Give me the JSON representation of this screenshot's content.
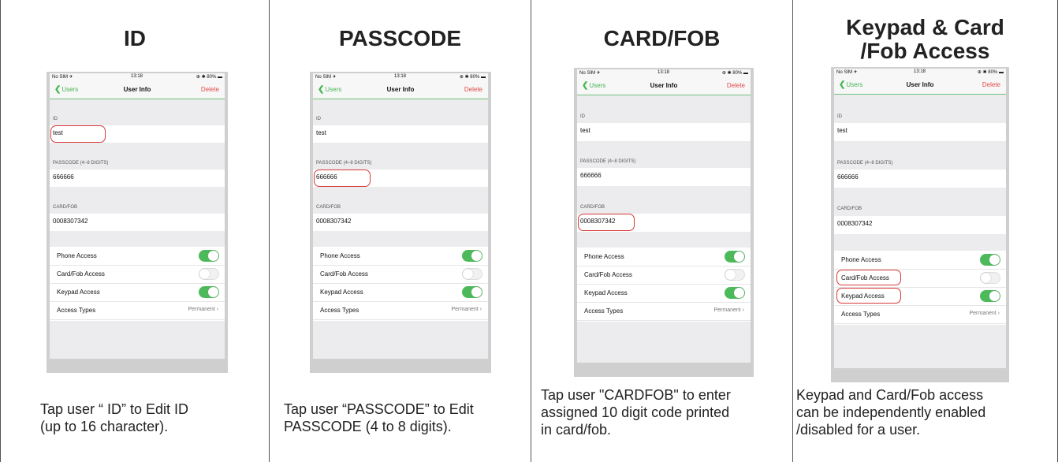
{
  "columns": [
    {
      "title": "ID",
      "caption": "Tap user “ ID” to Edit ID\n(up to 16 character)."
    },
    {
      "title": "PASSCODE",
      "caption": "Tap user “PASSCODE” to Edit\nPASSCODE (4 to 8 digits)."
    },
    {
      "title": "CARD/FOB",
      "caption": "Tap user \"CARDFOB\" to enter\nassigned 10 digit code printed\nin card/fob."
    },
    {
      "title": "Keypad & Card\n/Fob Access",
      "caption": "Keypad and Card/Fob access\ncan be independently enabled\n/disabled for a user."
    }
  ],
  "phone": {
    "status_left": "No SIM ✈",
    "status_time": "13:18",
    "status_right": "⊕ ✱ 80% ▬",
    "back_label": "Users",
    "nav_title": "User Info",
    "delete_label": "Delete",
    "id_header": "ID",
    "id_value": "test",
    "passcode_header": "PASSCODE (4~8 DIGITS)",
    "passcode_value": "666666",
    "card_header": "CARD/FOB",
    "card_value": "0008307342",
    "phone_access": "Phone Access",
    "card_access": "Card/Fob Access",
    "keypad_access": "Keypad Access",
    "access_types": "Access Types",
    "access_types_value": "Permanent",
    "phone_access_on": true,
    "card_access_on": false,
    "keypad_access_on": true
  },
  "colors": {
    "accent": "#45b653",
    "delete": "#e24a4a",
    "highlight": "#d83a3a"
  }
}
